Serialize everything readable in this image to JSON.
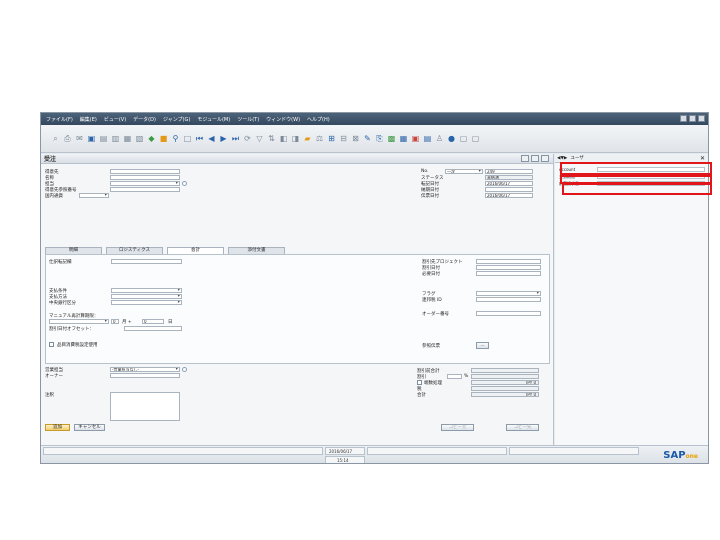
{
  "menu": [
    "ファイル(F)",
    "編集(E)",
    "ビュー(V)",
    "データ(D)",
    "ジャンプ(G)",
    "モジュール(M)",
    "ツール(T)",
    "ウィンドウ(W)",
    "ヘルプ(H)"
  ],
  "doc": {
    "title": "受注",
    "left_labels": [
      "得意先",
      "名称",
      "担当",
      "得意先参照番号",
      "国内通貨"
    ],
    "right_labels": [
      "No.",
      "ステータス",
      "転記日付",
      "納期日付",
      "伝票日付"
    ],
    "series": "一次",
    "doc_no": "249",
    "status_value": "未結済",
    "posting_date": "2016/06/17",
    "doc_date": "2016/06/17"
  },
  "tabs": [
    "明細",
    "ロジスティクス",
    "会計",
    "添付文書"
  ],
  "accounting": {
    "left": [
      "仕訳転記欄",
      "支払条件",
      "支払方法",
      "中央銀行区分",
      "マニュアル再計算期限：",
      "割引日付オフセット："
    ],
    "months_label": "月 +",
    "days_label": "日",
    "months_value": "0",
    "days_value": "0",
    "checkbox_label": "品目消費税設定使用",
    "right": [
      "割引先プロジェクト",
      "割引日付",
      "必要日付",
      "フラグ",
      "連邦税 ID",
      "オーダー番号",
      "参照伝票"
    ]
  },
  "footer_left": [
    "営業担当",
    "オーナー",
    "注釈"
  ],
  "sales_employee": "-営業担当なし-",
  "totals": {
    "labels": [
      "割引前合計",
      "割引",
      "端数処理",
      "税",
      "合計"
    ],
    "pct": "%",
    "tax_value": "JPY 0",
    "total_value": "JPY 0",
    "rounding_value": "JPY 0"
  },
  "buttons": {
    "add": "追加",
    "cancel": "キャンセル",
    "copy_from": "コピー元",
    "copy_to": "コピー先"
  },
  "statusbar": {
    "date": "2016/06/17",
    "time": "15:14"
  },
  "brand": {
    "sap": "SAP",
    "one": "one"
  },
  "side": {
    "title": "ユーザ",
    "rows": [
      "Account",
      "支払期限",
      "前受請求書"
    ]
  }
}
